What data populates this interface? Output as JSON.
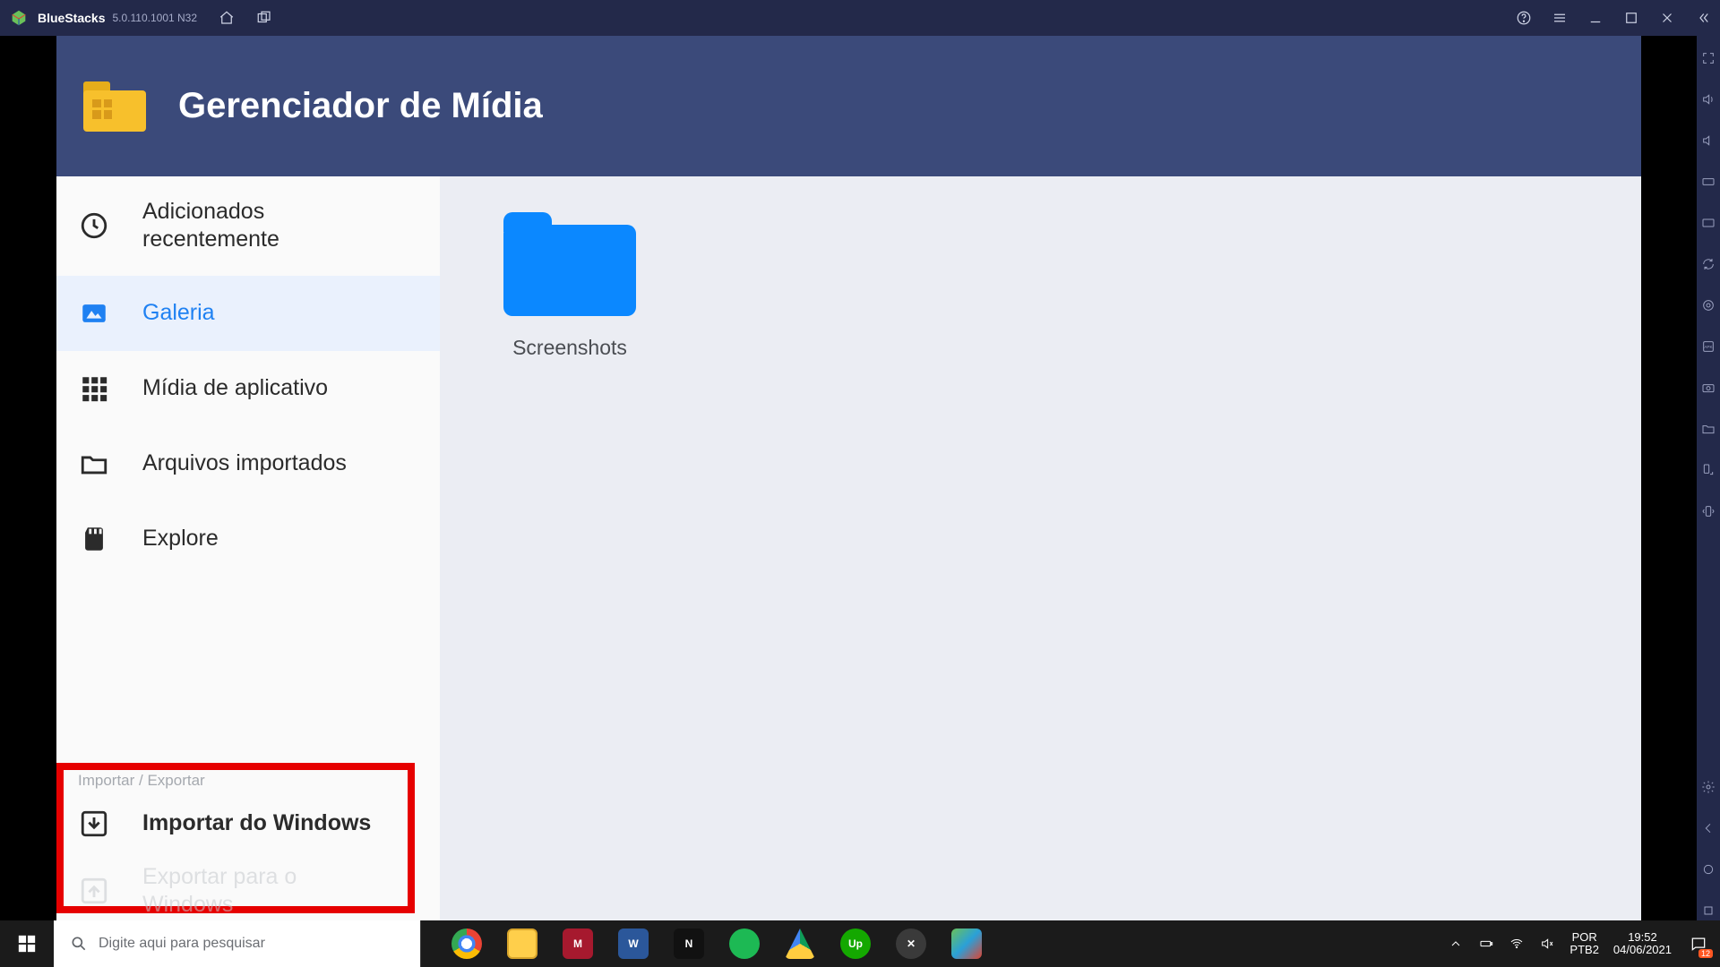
{
  "bluestacks": {
    "name": "BlueStacks",
    "version": "5.0.110.1001 N32"
  },
  "app": {
    "title": "Gerenciador de Mídia"
  },
  "sidebar": {
    "items": {
      "recent": "Adicionados recentemente",
      "gallery": "Galeria",
      "appmedia": "Mídia de aplicativo",
      "imported": "Arquivos importados",
      "explore": "Explore"
    },
    "section_label": "Importar / Exportar",
    "import_windows": "Importar do Windows",
    "export_windows": "Exportar para o Windows"
  },
  "content": {
    "folder1": "Screenshots"
  },
  "taskbar": {
    "search_placeholder": "Digite aqui para pesquisar",
    "lang_top": "POR",
    "lang_bottom": "PTB2",
    "time": "19:52",
    "date": "04/06/2021",
    "notif_count": "12"
  }
}
